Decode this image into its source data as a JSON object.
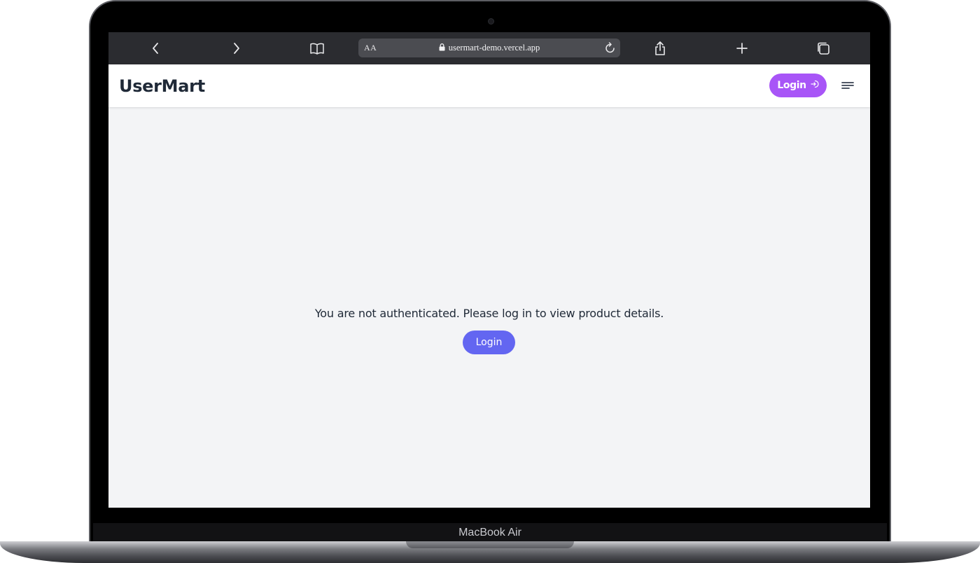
{
  "device": {
    "label": "MacBook Air"
  },
  "browser": {
    "reader_label": "AA",
    "url": "usermart-demo.vercel.app"
  },
  "app": {
    "brand": "UserMart",
    "nav_login_label": "Login",
    "message": "You are not authenticated. Please log in to view product details.",
    "login_button_label": "Login"
  },
  "colors": {
    "nav_login_bg": "#a855f7",
    "main_login_bg": "#6366f1",
    "page_bg": "#f3f4f6"
  }
}
